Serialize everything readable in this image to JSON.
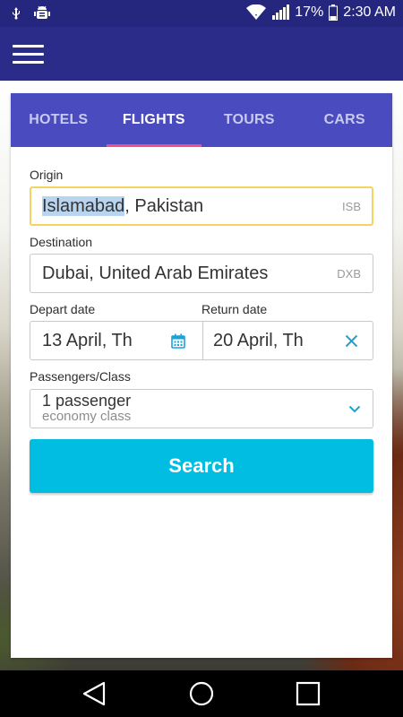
{
  "status_bar": {
    "battery_percent": "17%",
    "time": "2:30 AM",
    "icons": [
      "usb-icon",
      "android-debug-icon",
      "wifi-icon",
      "signal-icon",
      "battery-icon"
    ]
  },
  "app_bar": {
    "menu_icon": "hamburger-menu-icon"
  },
  "tabs": [
    {
      "label": "HOTELS",
      "active": false
    },
    {
      "label": "FLIGHTS",
      "active": true
    },
    {
      "label": "TOURS",
      "active": false
    },
    {
      "label": "CARS",
      "active": false
    }
  ],
  "form": {
    "origin": {
      "label": "Origin",
      "value_selected": "Islamabad",
      "value_rest": ", Pakistan",
      "code": "ISB"
    },
    "destination": {
      "label": "Destination",
      "value": "Dubai, United Arab Emirates",
      "code": "DXB"
    },
    "depart": {
      "label": "Depart date",
      "value": "13 April, Th",
      "icon": "calendar-icon"
    },
    "return": {
      "label": "Return date",
      "value": "20 April, Th",
      "icon": "clear-x-icon"
    },
    "passengers": {
      "label": "Passengers/Class",
      "count": "1 passenger",
      "class": "economy class",
      "icon": "chevron-down-icon"
    },
    "search_label": "Search"
  },
  "colors": {
    "status_bar": "#25267e",
    "app_bar": "#2b2c89",
    "tabs_bg": "#4a4bbf",
    "tab_indicator": "#ee4f86",
    "focus_border": "#f4d35e",
    "search_button": "#00bde1",
    "icon_accent": "#1aa3d9"
  },
  "nav_bar": {
    "icons": [
      "back-icon",
      "home-icon",
      "recents-icon"
    ]
  }
}
